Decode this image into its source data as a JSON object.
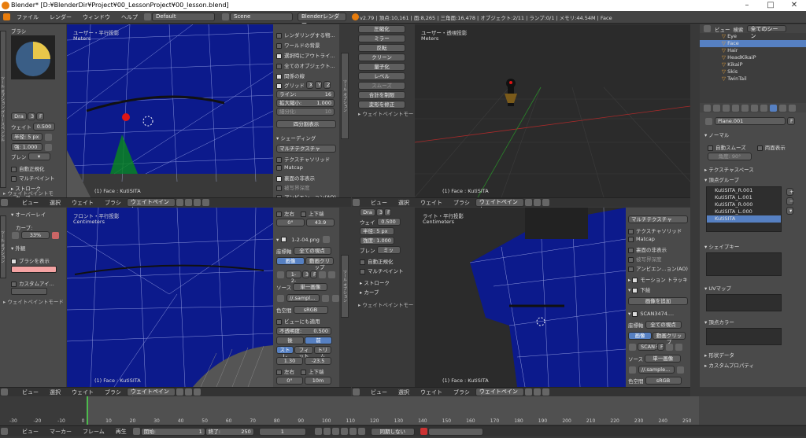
{
  "window": {
    "title": "Blender* [D:¥BlenderDir¥Project¥00_LessonProject¥00_lesson.blend]"
  },
  "menubar": {
    "items": [
      "ファイル",
      "レンダー",
      "ウィンドウ",
      "ヘルプ"
    ],
    "layout": "Default",
    "scene": "Scene",
    "engine": "Blenderレンダー",
    "stats": "v2.79 | 頂点:10,161 | 面:8,265 | 三角面:16,478 | オブジェクト:2/11 | ランプ:0/1 | メモリ:44.54M | Face"
  },
  "brush_panel": {
    "title": "ブラシ",
    "name": "Dra",
    "num": "3",
    "weight_label": "ウェイト",
    "weight": "0.500",
    "radius_label": "半径:",
    "radius": "5 px",
    "strength_label": "強:",
    "strength": "1.000",
    "blend_label": "ブレン",
    "autonorm": "自動正規化",
    "multipaint": "マルチペイント",
    "stroke": "ストローク",
    "curve": "カーブ",
    "mode": "ウェイトペイントモ"
  },
  "viewport_tl": {
    "view_name": "ユーザー・平行投影",
    "units": "Meters",
    "object": "(1) Face : KutiSITA"
  },
  "mid_panel": {
    "items": [
      "レンダリングする物...",
      "ワールドの背景",
      "選択時にアウトライ...",
      "全てのオブジェクト...",
      "関係の線"
    ],
    "grid": "グリッド",
    "axes": [
      "X",
      "Y",
      "Z"
    ],
    "lines_label": "ライン:",
    "lines": "16",
    "scale_label": "拡大縮小:",
    "scale": "1.000",
    "sub_label": "細分化:",
    "sub": "10",
    "quad": "四分割表示",
    "shading": "シェーディング",
    "matcap_mode": "マルチテクスチャ",
    "tex_solid": "テクスチャソリッド",
    "matcap": "Matcap",
    "backface": "裏面の非表示",
    "depth": "被写界深度",
    "ao": "アンビエン...ョン(AO)"
  },
  "tools": {
    "items": [
      "圧縮化",
      "ミラー",
      "反転",
      "クリーン",
      "量子化",
      "レベル",
      "スムーズ",
      "合計を制限",
      "変形を修正"
    ],
    "mode": "ウェイトペイントモード"
  },
  "viewport_tr": {
    "view_name": "ユーザー・透視投影",
    "units": "Meters",
    "object": "(1) Face : KutiSITA"
  },
  "header_common": {
    "view": "ビュー",
    "select": "選択",
    "weight": "ウェイト",
    "brush": "ブラシ",
    "mode": "ウェイトペイント"
  },
  "overlay_panel": {
    "title": "オーバーレイ",
    "curve": "カーブ:",
    "percent": "33%",
    "outline": "外観",
    "show_brush": "ブラシを表示",
    "custom_icon": "カスタムアイ...",
    "mode": "ウェイトペイントモード"
  },
  "viewport_bl": {
    "view_name": "フロント・平行投影",
    "units": "Centimeters",
    "object": "(1) Face : KutiSITA"
  },
  "bg_panel": {
    "lr": "左右",
    "ud": "上下端",
    "zero": "0°",
    "val1": "43.9",
    "image_title": "1-2-04.png",
    "axis_label": "座標軸",
    "axis": "全ての視点",
    "image": "画像",
    "movie": "動画クリップ",
    "img_name": "1-2-",
    "img_num": "3",
    "source_label": "ソース",
    "source": "単一画像",
    "path": "//.sampl...",
    "colorspace_label": "色空間",
    "colorspace": "sRGB",
    "view_as": "ビューにも適用",
    "opacity_label": "不透明度:",
    "opacity": "0.500",
    "back": "後",
    "front": "前",
    "stretch": "ストレ",
    "fit": "フィット",
    "crop": "トリム",
    "x": "1.30",
    "y": "-23.5",
    "zero2": "0°",
    "size": "10m"
  },
  "float_panel": {
    "name": "Dra",
    "num": "3",
    "weight_label": "ウェイ",
    "weight": "0.500",
    "radius_label": "半径:",
    "radius": "5 px",
    "strength_label": "強度:",
    "strength": "1.000",
    "blend_label": "ブレン",
    "blend": "ミッ",
    "autonorm": "自動正規化",
    "multipaint": "マルチペイント",
    "stroke": "ストローク",
    "curve": "カーブ",
    "mode": "ウェイトペイントモード"
  },
  "viewport_br": {
    "view_name": "ライト・平行投影",
    "units": "Centimeters",
    "object": "(1) Face : KutiSITA"
  },
  "right_mid": {
    "items": [
      "マルチテクスチャ",
      "テクスチャソリッド",
      "Matcap",
      "裏面の非表示",
      "被写界深度",
      "アンビエン...ョン(AO)"
    ],
    "motion": "モーション トラッキ",
    "bg": "下絵",
    "add_image": "画像を追加",
    "scan": "SCAN3474....",
    "axis_label": "座標軸",
    "axis": "全ての視点",
    "image": "画像",
    "movie": "動画クリップ",
    "img": "SCAN3",
    "f": "F",
    "source_label": "ソース",
    "source": "単一画像",
    "path": "//.sample...",
    "colorspace_label": "色空間",
    "colorspace": "sRGB"
  },
  "outliner": {
    "header": [
      "ビュー",
      "検索",
      "全てのシーン"
    ],
    "items": [
      "Eye",
      "Face",
      "Hair",
      "HeadKikaiP",
      "KikaiP",
      "Skis",
      "TwinTail"
    ]
  },
  "props": {
    "object": "Plane.001",
    "f": "F",
    "normal": "ノーマル",
    "auto_smooth": "自動スムーズ",
    "double": "両面表示",
    "angle": "角度:",
    "angle_val": "90°",
    "texspace": "テクスチャスペース",
    "vgroups": "頂点グループ",
    "groups": [
      "KutiSITA_R.001",
      "KutiSITA_L.001",
      "KutiSITA_R.000",
      "KutiSITA_L.000",
      "KutiSITA"
    ],
    "shapekeys": "シェイプキー",
    "uvmap": "UVマップ",
    "vcolors": "頂点カラー",
    "shape_data": "形状データ",
    "custom_props": "カスタムプロパティ"
  },
  "timeline": {
    "ticks": [
      "-30",
      "-20",
      "-10",
      "0",
      "10",
      "20",
      "30",
      "40",
      "50",
      "60",
      "70",
      "80",
      "90",
      "100",
      "110",
      "120",
      "130",
      "140",
      "150",
      "160",
      "170",
      "180",
      "190",
      "200",
      "210",
      "220",
      "230",
      "240",
      "250"
    ],
    "menus": [
      "ビュー",
      "マーカー",
      "フレーム",
      "再生"
    ],
    "start_label": "開始:",
    "start": "1",
    "end_label": "終了:",
    "end": "250",
    "current": "1",
    "sync": "同期しない"
  }
}
